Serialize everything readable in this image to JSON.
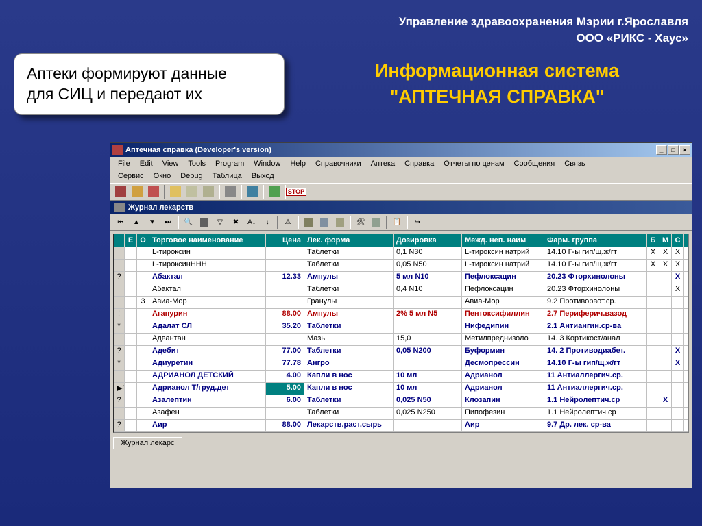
{
  "header": {
    "line1": "Управление здравоохранения Мэрии г.Ярославля",
    "line2": "ООО «РИКС - Хаус»"
  },
  "caption": {
    "line1": "Аптеки формируют данные",
    "line2": "для СИЦ и передают их"
  },
  "title_right": {
    "line1": "Информационная система",
    "line2": "\"АПТЕЧНАЯ СПРАВКА\""
  },
  "window": {
    "title": "Аптечная справка (Developer's version)",
    "menu1": [
      "File",
      "Edit",
      "View",
      "Tools",
      "Program",
      "Window",
      "Help",
      "Справочники",
      "Аптека",
      "Справка",
      "Отчеты по ценам",
      "Сообщения",
      "Связь"
    ],
    "menu2": [
      "Сервис",
      "Окно",
      "Debug",
      "Таблица",
      "Выход"
    ],
    "stop_label": "STOP",
    "subwin_title": "Журнал лекарств",
    "bottom_tab": "Журнал лекарс",
    "columns": {
      "e": "Е",
      "o": "О",
      "name": "Торговое наименование",
      "price": "Цена",
      "form": "Лек. форма",
      "dose": "Дозировка",
      "inn": "Межд. неп. наим",
      "pharm": "Фарм. группа",
      "b": "Б",
      "m": "М",
      "c": "С"
    },
    "rows": [
      {
        "mark": "",
        "e": "",
        "o": "",
        "name": "L-тироксин",
        "price": "",
        "form": "Таблетки",
        "dose": "0,1 N30",
        "inn": "L-тироксин натрий",
        "pharm": "14.10 Г-ы гип/щ.ж/гт",
        "b": "X",
        "m": "X",
        "c": "X",
        "style": "plain"
      },
      {
        "mark": "",
        "e": "",
        "o": "",
        "name": "L-тироксинННН",
        "price": "",
        "form": "Таблетки",
        "dose": "0,05 N50",
        "inn": "L-тироксин натрий",
        "pharm": "14.10 Г-ы гип/щ.ж/гт",
        "b": "X",
        "m": "X",
        "c": "X",
        "style": "plain"
      },
      {
        "mark": "?",
        "e": "",
        "o": "",
        "name": "Абактал",
        "price": "12.33",
        "form": "Ампулы",
        "dose": "5 мл N10",
        "inn": "Пефлоксацин",
        "pharm": "20.23 Фторхинолоны",
        "b": "",
        "m": "",
        "c": "X",
        "style": "bold"
      },
      {
        "mark": "",
        "e": "",
        "o": "",
        "name": "Абактал",
        "price": "",
        "form": "Таблетки",
        "dose": "0,4 N10",
        "inn": "Пефлоксацин",
        "pharm": "20.23 Фторхинолоны",
        "b": "",
        "m": "",
        "c": "X",
        "style": "plain"
      },
      {
        "mark": "",
        "e": "",
        "o": "3",
        "name": "Авиа-Мор",
        "price": "",
        "form": "Гранулы",
        "dose": "",
        "inn": "Авиа-Мор",
        "pharm": "9.2 Противорвот.ср.",
        "b": "",
        "m": "",
        "c": "",
        "style": "plain"
      },
      {
        "mark": "!",
        "e": "",
        "o": "",
        "name": "Агапурин",
        "price": "88.00",
        "form": "Ампулы",
        "dose": "2% 5 мл N5",
        "inn": "Пентоксифиллин",
        "pharm": "2.7 Периферич.вазод",
        "b": "",
        "m": "",
        "c": "",
        "style": "red"
      },
      {
        "mark": "*",
        "e": "",
        "o": "",
        "name": "Адалат СЛ",
        "price": "35.20",
        "form": "Таблетки",
        "dose": "",
        "inn": "Нифедипин",
        "pharm": "2.1 Антиангин.ср-ва",
        "b": "",
        "m": "",
        "c": "",
        "style": "bold"
      },
      {
        "mark": "",
        "e": "",
        "o": "",
        "name": "Адвантан",
        "price": "",
        "form": "Мазь",
        "dose": "15,0",
        "inn": "Метилпреднизоло",
        "pharm": "14. 3 Кортикост/анал",
        "b": "",
        "m": "",
        "c": "",
        "style": "plain"
      },
      {
        "mark": "?",
        "e": "",
        "o": "",
        "name": "Адебит",
        "price": "77.00",
        "form": "Таблетки",
        "dose": "0,05 N200",
        "inn": "Буформин",
        "pharm": "14. 2 Противодиабет.",
        "b": "",
        "m": "",
        "c": "X",
        "style": "bold"
      },
      {
        "mark": "*",
        "e": "",
        "o": "",
        "name": "Адиуретин",
        "price": "77.78",
        "form": "Ангро",
        "dose": "",
        "inn": "Десмопрессин",
        "pharm": "14.10 Г-ы гип/щ.ж/гт",
        "b": "",
        "m": "",
        "c": "X",
        "style": "bold"
      },
      {
        "mark": "",
        "e": "",
        "o": "",
        "name": "АДРИАНОЛ ДЕТСКИЙ",
        "price": "4.00",
        "form": "Капли в нос",
        "dose": "10 мл",
        "inn": "Адрианол",
        "pharm": "11  Антиаллергич.ср.",
        "b": "",
        "m": "",
        "c": "",
        "style": "bold"
      },
      {
        "mark": "▶?",
        "e": "",
        "o": "",
        "name": "Адрианол Т/груд.дет",
        "price": "5.00",
        "form": "Капли в нос",
        "dose": "10 мл",
        "inn": "Адрианол",
        "pharm": "11  Антиаллергич.ср.",
        "b": "",
        "m": "",
        "c": "",
        "style": "bold",
        "selected_price": true
      },
      {
        "mark": "?",
        "e": "",
        "o": "",
        "name": "Азалептин",
        "price": "6.00",
        "form": "Таблетки",
        "dose": "0,025 N50",
        "inn": "Клозапин",
        "pharm": "1.1 Нейролептич.ср",
        "b": "",
        "m": "X",
        "c": "",
        "style": "bold"
      },
      {
        "mark": "",
        "e": "",
        "o": "",
        "name": "Азафен",
        "price": "",
        "form": "Таблетки",
        "dose": "0,025 N250",
        "inn": "Пипофезин",
        "pharm": "1.1 Нейролептич.ср",
        "b": "",
        "m": "",
        "c": "",
        "style": "plain"
      },
      {
        "mark": "?",
        "e": "",
        "o": "",
        "name": "Аир",
        "price": "88.00",
        "form": "Лекарств.раст.сырь",
        "dose": "",
        "inn": "Аир",
        "pharm": "9.7 Др. лек. ср-ва",
        "b": "",
        "m": "",
        "c": "",
        "style": "bold"
      }
    ]
  }
}
